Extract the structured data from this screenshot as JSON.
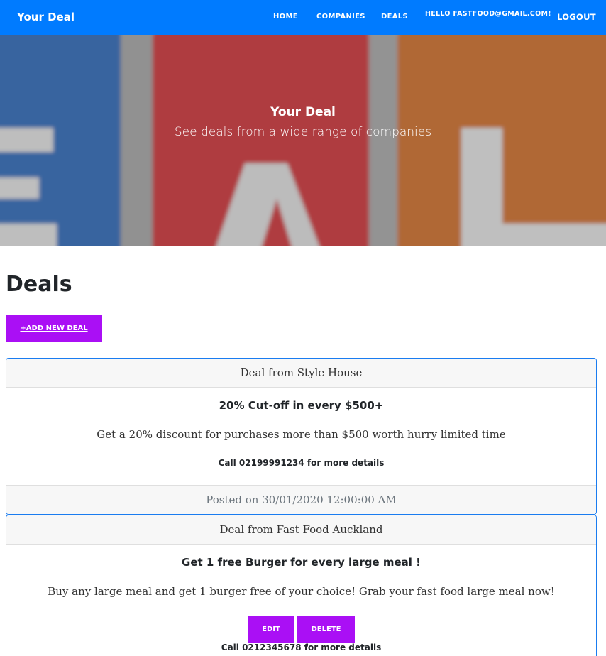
{
  "navbar": {
    "brand": "Your Deal",
    "links": {
      "home": "HOME",
      "companies": "COMPANIES",
      "deals": "DEALS",
      "hello": "HELLO FASTFOOD@GMAIL.COM!",
      "logout": "LOGOUT"
    },
    "color": "#007bff"
  },
  "hero": {
    "title": "Your Deal",
    "subtitle": "See deals from a wide range of companies"
  },
  "main": {
    "heading": "Deals",
    "add_button": "+ADD NEW DEAL",
    "accent_color": "#aa0ff5"
  },
  "deals": [
    {
      "header": "Deal from Style House",
      "title": "20% Cut-off in every $500+",
      "description": "Get a 20% discount for purchases more than $500 worth hurry limited time",
      "call": "Call 02199991234 for more details",
      "footer": "Posted on 30/01/2020 12:00:00 AM"
    },
    {
      "header": "Deal from Fast Food Auckland",
      "title": "Get 1 free Burger for every large meal !",
      "description": "Buy any large meal and get 1 burger free of your choice! Grab your fast food large meal now!",
      "edit_label": "EDIT",
      "delete_label": "DELETE",
      "call": "Call 0212345678 for more details"
    }
  ]
}
